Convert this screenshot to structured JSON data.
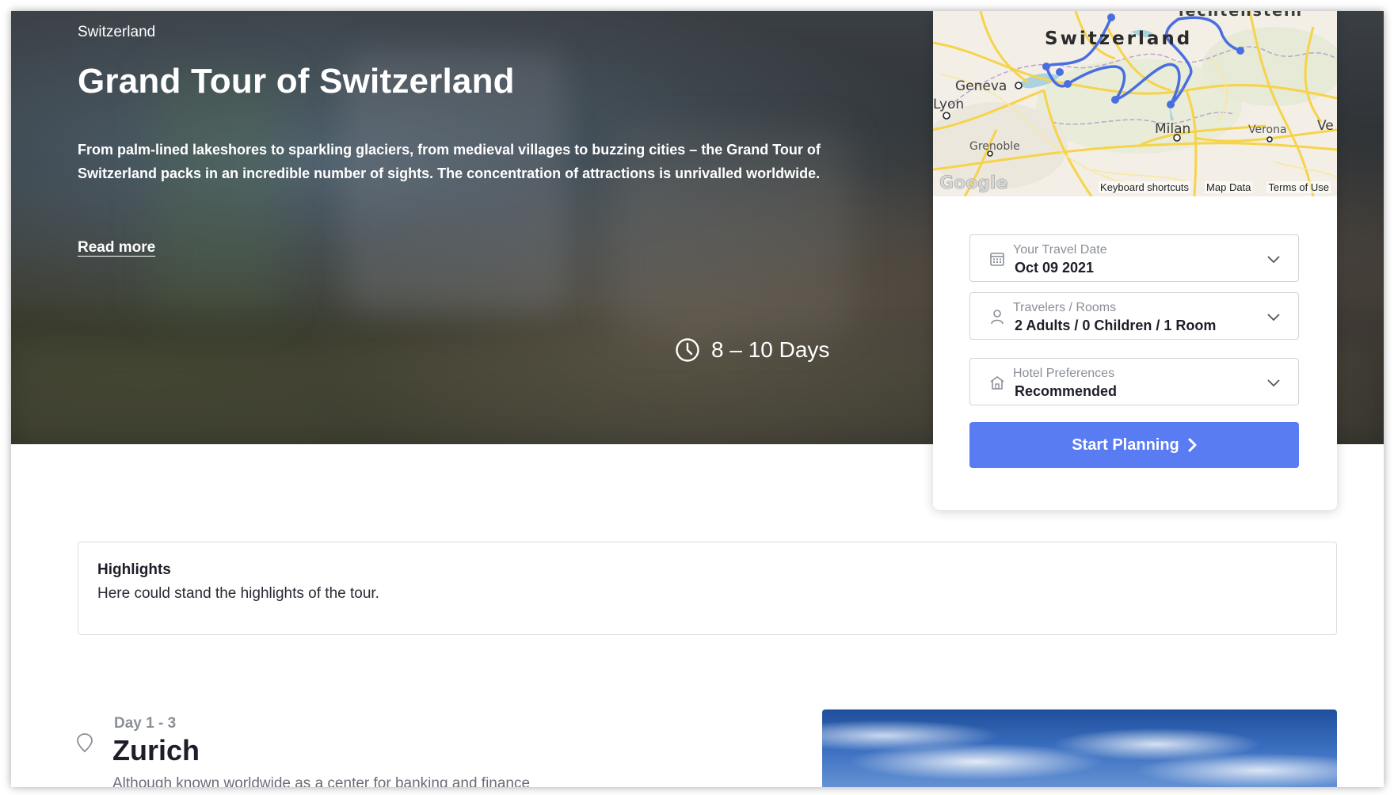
{
  "hero": {
    "country": "Switzerland",
    "title": "Grand Tour of Switzerland",
    "description": "From palm-lined lakeshores to sparkling glaciers, from medieval villages to buzzing cities – the Grand Tour of Switzerland packs in an incredible number of sights. The concentration of attractions is unrivalled worldwide.",
    "read_more": "Read more",
    "duration": "8 – 10 Days"
  },
  "map": {
    "labels": {
      "switzerland": "Switzerland",
      "liechtenstein": "iechtenstein",
      "geneva": "Geneva",
      "lyon": "Lyon",
      "milan": "Milan",
      "grenoble": "Grenoble",
      "verona": "Verona",
      "ve": "Ve",
      "logo": "Google"
    },
    "footer": {
      "shortcuts": "Keyboard shortcuts",
      "map_data": "Map Data",
      "terms": "Terms of Use"
    },
    "route_color": "#4a6ee0"
  },
  "booking": {
    "travel_date": {
      "label": "Your Travel Date",
      "value": "Oct 09 2021",
      "icon": "calendar-icon"
    },
    "travelers": {
      "label": "Travelers / Rooms",
      "value": "2 Adults / 0 Children / 1 Room",
      "icon": "person-icon"
    },
    "hotel": {
      "label": "Hotel Preferences",
      "value": "Recommended",
      "icon": "home-icon"
    },
    "start_button": "Start Planning",
    "accent_color": "#5a7cf3"
  },
  "highlights": {
    "title": "Highlights",
    "text": "Here could stand the highlights of the tour."
  },
  "day": {
    "label": "Day 1 - 3",
    "city": "Zurich",
    "excerpt": "Although known worldwide as a center for banking and finance"
  }
}
